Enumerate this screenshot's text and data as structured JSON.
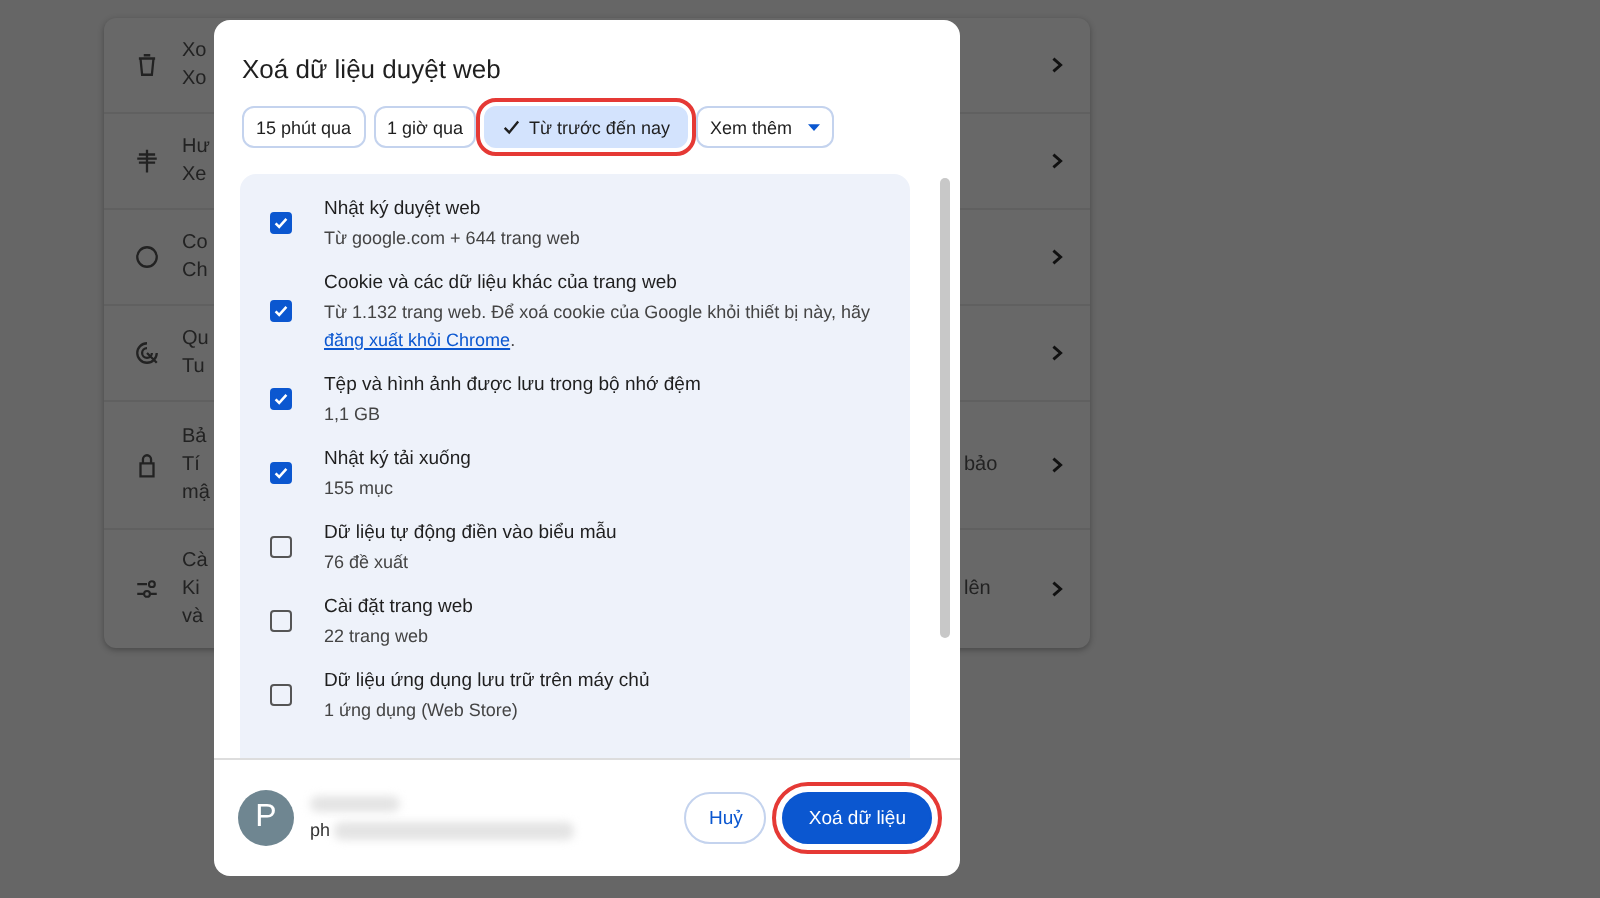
{
  "background_page": {
    "rows": [
      {
        "lines": [
          "Xo",
          "Xo"
        ]
      },
      {
        "lines": [
          "Hư",
          "Xe"
        ]
      },
      {
        "lines": [
          "Co",
          "Ch"
        ]
      },
      {
        "lines": [
          "Qu",
          "Tu"
        ]
      },
      {
        "lines": [
          "Bả",
          "Tí",
          "mậ"
        ],
        "trailing": "bảo"
      },
      {
        "lines": [
          "Cà",
          "Ki",
          "và"
        ],
        "trailing": "lên"
      }
    ]
  },
  "dialog": {
    "title": "Xoá dữ liệu duyệt web",
    "time_ranges": [
      {
        "label": "15 phút qua",
        "selected": false,
        "highlighted": false
      },
      {
        "label": "1 giờ qua",
        "selected": false,
        "highlighted": false
      },
      {
        "label": "Từ trước đến nay",
        "selected": true,
        "highlighted": true
      },
      {
        "label": "Xem thêm",
        "kind": "dropdown",
        "selected": false,
        "highlighted": false
      }
    ],
    "items": [
      {
        "title": "Nhật ký duyệt web",
        "detail": "Từ google.com + 644 trang web",
        "checked": true
      },
      {
        "title": "Cookie và các dữ liệu khác của trang web",
        "detail": "Từ 1.132 trang web. Để xoá cookie của Google khỏi thiết bị này, hãy",
        "link": "đăng xuất khỏi Chrome",
        "detail_end": ".",
        "checked": true
      },
      {
        "title": "Tệp và hình ảnh được lưu trong bộ nhớ đệm",
        "detail": "1,1 GB",
        "checked": true
      },
      {
        "title": "Nhật ký tải xuống",
        "detail": "155 mục",
        "checked": true
      },
      {
        "title": "Dữ liệu tự động điền vào biểu mẫu",
        "detail": "76 đề xuất",
        "checked": false
      },
      {
        "title": "Cài đặt trang web",
        "detail": "22 trang web",
        "checked": false
      },
      {
        "title": "Dữ liệu ứng dụng lưu trữ trên máy chủ",
        "detail": "1 ứng dụng (Web Store)",
        "checked": false
      }
    ],
    "account": {
      "initial": "P",
      "email": "ph"
    },
    "buttons": [
      {
        "label": "Huỷ",
        "kind": "secondary",
        "highlighted": false
      },
      {
        "label": "Xoá dữ liệu",
        "kind": "primary",
        "highlighted": true
      }
    ]
  }
}
